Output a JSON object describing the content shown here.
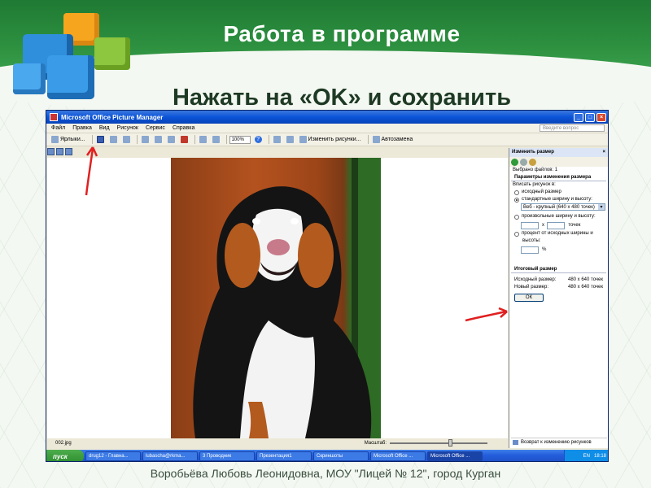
{
  "slide": {
    "title": "Работа в программе",
    "subtitle": "Нажать на «OK» и сохранить",
    "footer": "Воробьёва Любовь Леонидовна, МОУ \"Лицей № 12\", город Курган"
  },
  "window": {
    "title": "Microsoft Office Picture Manager",
    "menu": [
      "Файл",
      "Правка",
      "Вид",
      "Рисунок",
      "Сервис",
      "Справка"
    ],
    "help_placeholder": "Введите вопрос",
    "toolbar": {
      "shortcuts_label": "Ярлыки...",
      "zoom": "100%",
      "edit_label": "Изменить рисунки...",
      "autocorrect_label": "Автозамена"
    },
    "status": {
      "filename": "002.jpg",
      "zoom_label": "Масштаб:"
    }
  },
  "taskpane": {
    "title": "Изменить размер",
    "selected_files": "Выбрано файлов: 1",
    "params_header": "Параметры изменения размера",
    "fit_label": "Вписать рисунок в:",
    "option_original": "исходный размер",
    "option_standard": "стандартные ширину и высоту:",
    "standard_value": "Веб - крупный (640 x 480 точек)",
    "option_custom": "произвольные ширину и высоту:",
    "x_sep": "x",
    "points_unit": "точек",
    "option_percent_1": "процент от исходных ширины и",
    "option_percent_2": "высоты:",
    "percent_unit": "%",
    "result_header": "Итоговый размер",
    "original_size_label": "Исходный размер:",
    "original_size_value": "480 x 640 точек",
    "new_size_label": "Новый размер:",
    "new_size_value": "480 x 640 точек",
    "ok_label": "ОК",
    "back_link": "Возврат к изменению рисунков"
  },
  "taskbar": {
    "start_label": "пуск",
    "items": [
      "drug12 - Главна...",
      "lubascha@rkma...",
      "3 Проводник",
      "Презентация1",
      "Скриншоты",
      "Microsoft Office ...",
      "Microsoft Office ..."
    ],
    "lang": "EN",
    "clock": "18:18"
  },
  "colors": {
    "header_green": "#2c8f3f",
    "annotation_red": "#e02020"
  }
}
